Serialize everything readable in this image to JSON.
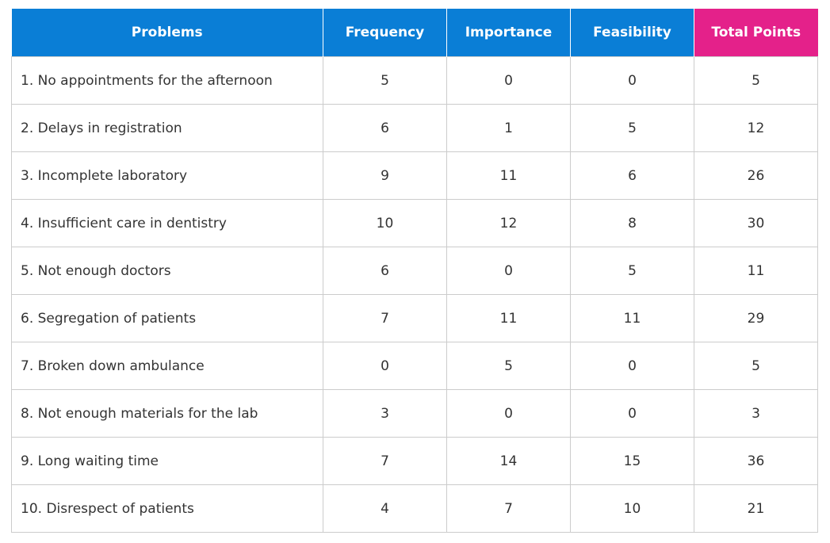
{
  "colors": {
    "header_blue": "#0a7ed6",
    "total_header": "#e4218a",
    "border": "#cccccc",
    "text": "#333333"
  },
  "table": {
    "headers": [
      "Problems",
      "Frequency",
      "Importance",
      "Feasibility",
      "Total Points"
    ],
    "rows": [
      [
        "1. No appointments for the afternoon",
        "5",
        "0",
        "0",
        "5"
      ],
      [
        "2. Delays in registration",
        "6",
        "1",
        "5",
        "12"
      ],
      [
        "3. Incomplete laboratory",
        "9",
        "11",
        "6",
        "26"
      ],
      [
        "4. Insufficient care in dentistry",
        "10",
        "12",
        "8",
        "30"
      ],
      [
        "5. Not enough doctors",
        "6",
        "0",
        "5",
        "11"
      ],
      [
        "6. Segregation of patients",
        "7",
        "11",
        "11",
        "29"
      ],
      [
        "7. Broken down ambulance",
        "0",
        "5",
        "0",
        "5"
      ],
      [
        "8. Not enough materials for the lab",
        "3",
        "0",
        "0",
        "3"
      ],
      [
        "9. Long waiting time",
        "7",
        "14",
        "15",
        "36"
      ],
      [
        "10. Disrespect of patients",
        "4",
        "7",
        "10",
        "21"
      ]
    ]
  }
}
